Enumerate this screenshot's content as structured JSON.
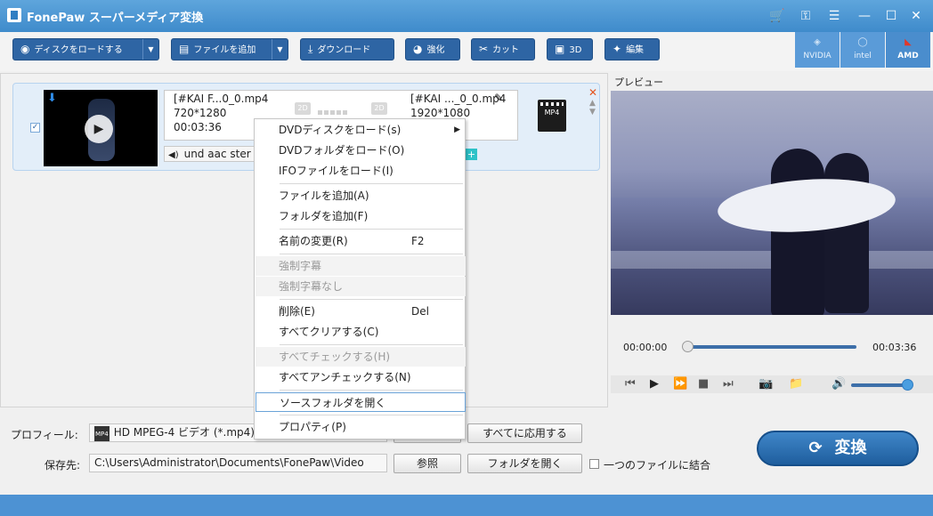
{
  "window": {
    "title": "FonePaw スーパーメディア変換"
  },
  "toolbar": {
    "load_disc": "ディスクをロードする",
    "add_file": "ファイルを追加",
    "download": "ダウンロード",
    "enhance": "強化",
    "cut": "カット",
    "three_d": "3D",
    "edit": "編集",
    "gpu": [
      {
        "label": "NVIDIA"
      },
      {
        "label": "intel"
      },
      {
        "label": "AMD"
      }
    ]
  },
  "file": {
    "source_name": "[#KAI F...0_0.mp4",
    "source_res": "720*1280",
    "source_duration": "00:03:36",
    "output_name": "[#KAI ..._0_0.mp4",
    "output_res": "1920*1080",
    "badge_2d": "2D",
    "format_badge": "MP4",
    "audio_track": "und aac ster"
  },
  "context_menu": {
    "items": [
      {
        "label": "DVDディスクをロード(s)",
        "shortcut": "",
        "submenu": true,
        "disabled": false
      },
      {
        "label": "DVDフォルダをロード(O)",
        "shortcut": "",
        "submenu": false,
        "disabled": false
      },
      {
        "label": "IFOファイルをロード(I)",
        "shortcut": "",
        "submenu": false,
        "disabled": false
      },
      {
        "label": "ファイルを追加(A)",
        "shortcut": "",
        "submenu": false,
        "disabled": false
      },
      {
        "label": "フォルダを追加(F)",
        "shortcut": "",
        "submenu": false,
        "disabled": false
      },
      {
        "label": "名前の変更(R)",
        "shortcut": "F2",
        "submenu": false,
        "disabled": false
      },
      {
        "label": "強制字幕",
        "shortcut": "",
        "submenu": false,
        "disabled": true
      },
      {
        "label": "強制字幕なし",
        "shortcut": "",
        "submenu": false,
        "disabled": true
      },
      {
        "label": "削除(E)",
        "shortcut": "Del",
        "submenu": false,
        "disabled": false
      },
      {
        "label": "すべてクリアする(C)",
        "shortcut": "",
        "submenu": false,
        "disabled": false
      },
      {
        "label": "すべてチェックする(H)",
        "shortcut": "",
        "submenu": false,
        "disabled": true
      },
      {
        "label": "すべてアンチェックする(N)",
        "shortcut": "",
        "submenu": false,
        "disabled": false
      },
      {
        "label": "ソースフォルダを開く",
        "shortcut": "",
        "submenu": false,
        "disabled": false,
        "highlighted": true
      },
      {
        "label": "プロパティ(P)",
        "shortcut": "",
        "submenu": false,
        "disabled": false
      }
    ]
  },
  "preview": {
    "label": "プレビュー",
    "time_current": "00:00:00",
    "time_total": "00:03:36",
    "progress": 0,
    "volume": 1.0
  },
  "bottom": {
    "profile_label": "プロフィール:",
    "profile_value": "HD MPEG-4 ビデオ (*.mp4)",
    "profile_icon_text": "MP4",
    "apply_all": "すべてに応用する",
    "save_label": "保存先:",
    "save_path": "C:\\Users\\Administrator\\Documents\\FonePaw\\Video",
    "browse": "参照",
    "open_folder": "フォルダを開く",
    "merge_label": "一つのファイルに結合",
    "convert": "変換"
  },
  "colors": {
    "accent": "#2e65a4",
    "title_bar": "#4a96d4",
    "status_bar": "#4d92d3"
  }
}
